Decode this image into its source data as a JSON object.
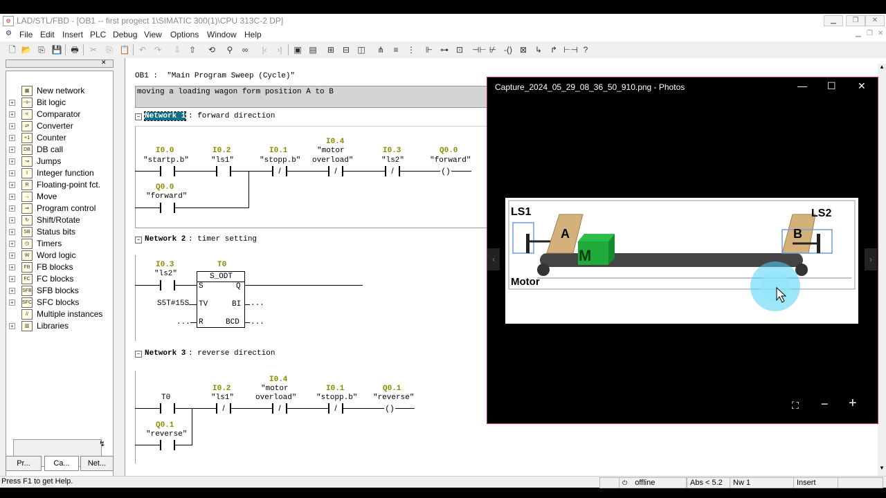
{
  "window": {
    "title": "LAD/STL/FBD  - [OB1 -- first progect 1\\SIMATIC 300(1)\\CPU 313C-2 DP]"
  },
  "menu": [
    "File",
    "Edit",
    "Insert",
    "PLC",
    "Debug",
    "View",
    "Options",
    "Window",
    "Help"
  ],
  "tree": {
    "items": [
      {
        "label": "New network",
        "icon": "new-network-icon",
        "glyph": ""
      },
      {
        "label": "Bit logic",
        "icon": "bit-logic-icon",
        "glyph": "+"
      },
      {
        "label": "Comparator",
        "icon": "comparator-icon",
        "glyph": "+"
      },
      {
        "label": "Converter",
        "icon": "converter-icon",
        "glyph": "+"
      },
      {
        "label": "Counter",
        "icon": "counter-icon",
        "glyph": "+"
      },
      {
        "label": "DB call",
        "icon": "db-call-icon",
        "glyph": "+"
      },
      {
        "label": "Jumps",
        "icon": "jumps-icon",
        "glyph": "+"
      },
      {
        "label": "Integer function",
        "icon": "integer-function-icon",
        "glyph": "+"
      },
      {
        "label": "Floating-point fct.",
        "icon": "floating-point-icon",
        "glyph": "+"
      },
      {
        "label": "Move",
        "icon": "move-icon",
        "glyph": "+"
      },
      {
        "label": "Program control",
        "icon": "program-control-icon",
        "glyph": "+"
      },
      {
        "label": "Shift/Rotate",
        "icon": "shift-rotate-icon",
        "glyph": "+"
      },
      {
        "label": "Status bits",
        "icon": "status-bits-icon",
        "glyph": "+"
      },
      {
        "label": "Timers",
        "icon": "timers-icon",
        "glyph": "+"
      },
      {
        "label": "Word logic",
        "icon": "word-logic-icon",
        "glyph": "+"
      },
      {
        "label": "FB blocks",
        "icon": "fb-blocks-icon",
        "glyph": "+"
      },
      {
        "label": "FC blocks",
        "icon": "fc-blocks-icon",
        "glyph": "+"
      },
      {
        "label": "SFB blocks",
        "icon": "sfb-blocks-icon",
        "glyph": "+"
      },
      {
        "label": "SFC blocks",
        "icon": "sfc-blocks-icon",
        "glyph": "+"
      },
      {
        "label": "Multiple instances",
        "icon": "multiple-instances-icon",
        "glyph": ""
      },
      {
        "label": "Libraries",
        "icon": "libraries-icon",
        "glyph": "+"
      }
    ],
    "tabs": [
      "Pr...",
      "Ca...",
      "Net..."
    ]
  },
  "editor": {
    "ob_header": "OB1 :  \"Main Program Sweep (Cycle)\"",
    "comment": "moving a loading wagon form position A to B",
    "network1": {
      "title_highlight": "Network 1",
      "title_rest": ": forward direction",
      "contacts": [
        {
          "addr": "I0.0",
          "sym": "\"startp.b\""
        },
        {
          "addr": "I0.2",
          "sym": "\"ls1\""
        },
        {
          "addr": "I0.1",
          "sym": "\"stopp.b\""
        },
        {
          "addr": "I0.4",
          "sym1": "\"motor",
          "sym2": "overload\""
        },
        {
          "addr": "I0.3",
          "sym": "\"ls2\""
        },
        {
          "addr": "Q0.0",
          "sym": "\"forward\""
        }
      ],
      "branch": {
        "addr": "Q0.0",
        "sym": "\"forward\""
      }
    },
    "network2": {
      "title_prefix": "Network 2",
      "title_rest": ": timer setting",
      "contact": {
        "addr": "I0.3",
        "sym": "\"ls2\""
      },
      "timer": {
        "addr": "T0",
        "type": "S_ODT",
        "pin_s": "S",
        "pin_q": "Q",
        "pin_tv": "TV",
        "pin_bi": "BI",
        "pin_r": "R",
        "pin_bcd": "BCD",
        "tv_value": "S5T#15S",
        "open": "..."
      }
    },
    "network3": {
      "title_prefix": "Network 3",
      "title_rest": ": reverse direction",
      "contacts": [
        {
          "addr": "",
          "sym": "T0"
        },
        {
          "addr": "I0.2",
          "sym": "\"ls1\""
        },
        {
          "addr": "I0.4",
          "sym1": "\"motor",
          "sym2": "overload\""
        },
        {
          "addr": "I0.1",
          "sym": "\"stopp.b\""
        },
        {
          "addr": "Q0.1",
          "sym": "\"reverse\""
        }
      ],
      "branch": {
        "addr": "Q0.1",
        "sym": "\"reverse\""
      }
    }
  },
  "photos": {
    "title": "Capture_2024_05_29_08_36_50_910.png - Photos",
    "image_labels": {
      "ls1": "LS1",
      "ls2": "LS2",
      "a": "A",
      "b": "B",
      "m": "M",
      "motor": "Motor"
    }
  },
  "status": {
    "help": "Press F1 to get Help.",
    "online": "offline",
    "abs": "Abs < 5.2",
    "nw": "Nw 1",
    "mode": "Insert"
  },
  "colors": {
    "address": "#8a8a00",
    "photos_border": "#c0306a",
    "cursor_glow": "#4fd3f5",
    "box_green": "#1faa3a",
    "wagon": "#d4b07a"
  }
}
